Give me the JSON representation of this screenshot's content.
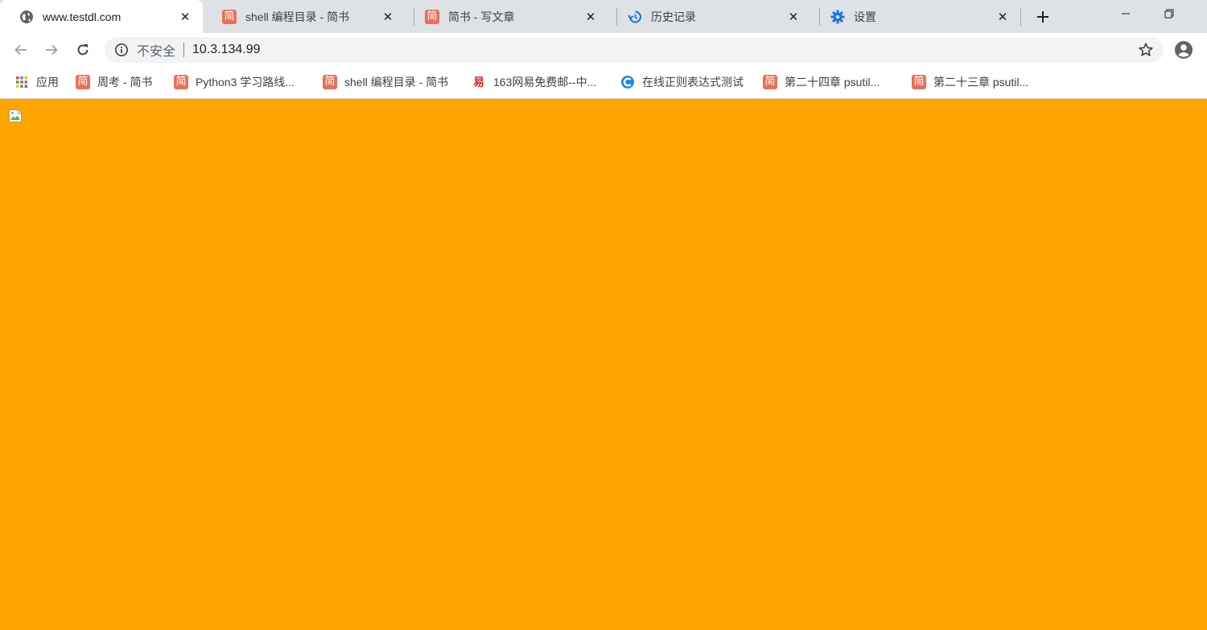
{
  "tabs": [
    {
      "title": "www.testdl.com",
      "icon": "globe-icon",
      "active": true
    },
    {
      "title": "shell 编程目录 - 简书",
      "icon": "jianshu-icon",
      "icon_glyph": "简"
    },
    {
      "title": "简书 - 写文章",
      "icon": "jianshu-icon",
      "icon_glyph": "简"
    },
    {
      "title": "历史记录",
      "icon": "history-icon"
    },
    {
      "title": "设置",
      "icon": "gear-icon"
    }
  ],
  "toolbar": {
    "security_label": "不安全",
    "url": "10.3.134.99"
  },
  "bookmarks": [
    {
      "label": "应用",
      "icon": "apps-grid-icon"
    },
    {
      "label": "周考 - 简书",
      "icon": "jianshu-icon",
      "icon_glyph": "简"
    },
    {
      "label": "Python3 学习路线...",
      "icon": "jianshu-icon",
      "icon_glyph": "简"
    },
    {
      "label": "shell 编程目录 - 简书",
      "icon": "jianshu-icon",
      "icon_glyph": "简"
    },
    {
      "label": "163网易免费邮--中...",
      "icon": "netease-icon",
      "icon_glyph": "易"
    },
    {
      "label": "在线正则表达式测试",
      "icon": "c-logo-icon"
    },
    {
      "label": "第二十四章 psutil...",
      "icon": "jianshu-icon",
      "icon_glyph": "简"
    },
    {
      "label": "第二十三章 psutil...",
      "icon": "jianshu-icon",
      "icon_glyph": "简"
    }
  ],
  "colors": {
    "page_background": "#ffa500",
    "tabstrip": "#dee1e6",
    "jianshu": "#ea6f5a",
    "blue_icon": "#1a73e8"
  }
}
